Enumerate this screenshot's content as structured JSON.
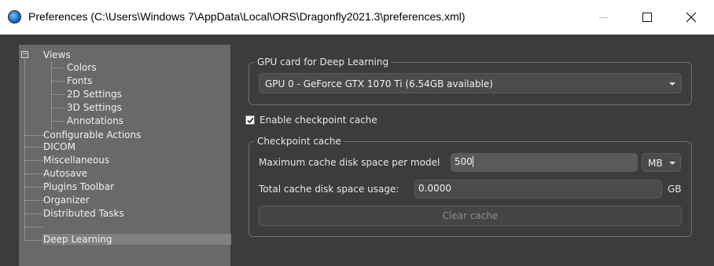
{
  "window": {
    "title": "Preferences (C:\\Users\\Windows 7\\AppData\\Local\\ORS\\Dragonfly2021.3\\preferences.xml)",
    "icon": "dragonfly-app-icon"
  },
  "tree": {
    "items": [
      {
        "label": "Views",
        "expanded": true
      },
      {
        "label": "Colors"
      },
      {
        "label": "Fonts"
      },
      {
        "label": "2D Settings"
      },
      {
        "label": "3D Settings"
      },
      {
        "label": "Annotations"
      },
      {
        "label": "Configurable Actions"
      },
      {
        "label": "DICOM"
      },
      {
        "label": "Miscellaneous"
      },
      {
        "label": "Autosave"
      },
      {
        "label": "Plugins Toolbar"
      },
      {
        "label": "Organizer"
      },
      {
        "label": "Distributed Tasks"
      },
      {
        "label": "Deep Learning",
        "selected": true
      }
    ]
  },
  "gpu_group": {
    "title": "GPU card for Deep Learning",
    "selected_gpu": "GPU 0 - GeForce GTX 1070 Ti (6.54GB available)"
  },
  "checkpoint": {
    "enable_label": "Enable checkpoint cache",
    "enabled": true,
    "group_title": "Checkpoint cache",
    "max_label": "Maximum cache disk space per model",
    "max_value": "500",
    "unit_selected": "MB",
    "total_label": "Total cache disk space usage:",
    "total_value": "0.0000",
    "total_unit": "GB",
    "clear_button": "Clear cache"
  },
  "colors": {
    "background": "#3c3c3c",
    "tree_background": "#696969",
    "selection": "#808080"
  }
}
